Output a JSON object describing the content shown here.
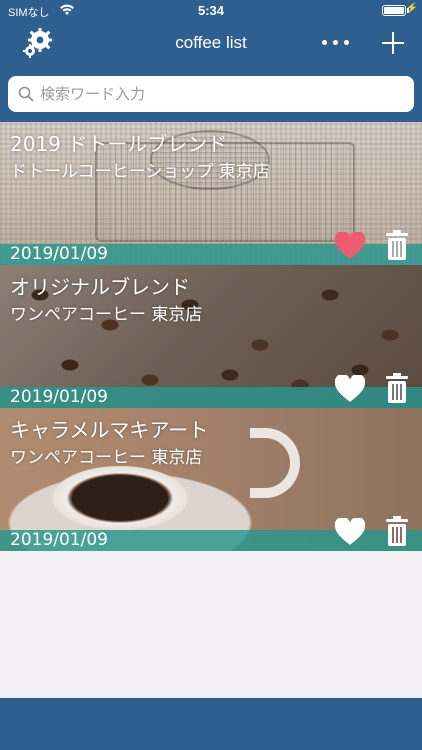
{
  "status": {
    "carrier": "SIMなし",
    "time": "5:34"
  },
  "nav": {
    "title": "coffee list",
    "settings_icon": "gear-icon",
    "more_icon": "more-dots-icon",
    "add_icon": "plus-icon"
  },
  "search": {
    "placeholder": "検索ワード入力",
    "value": ""
  },
  "items": [
    {
      "name": "2019 ドトールブレンド",
      "shop": "ドトールコーヒーショップ 東京店",
      "date": "2019/01/09",
      "favorite": true
    },
    {
      "name": "オリジナルブレンド",
      "shop": "ワンペアコーヒー 東京店",
      "date": "2019/01/09",
      "favorite": false
    },
    {
      "name": "キャラメルマキアート",
      "shop": "ワンペアコーヒー 東京店",
      "date": "2019/01/09",
      "favorite": false
    }
  ],
  "colors": {
    "bar": "#2f5f8f",
    "strip": "#28968c",
    "heart_active": "#ef5a73",
    "heart_inactive": "#ffffff"
  }
}
